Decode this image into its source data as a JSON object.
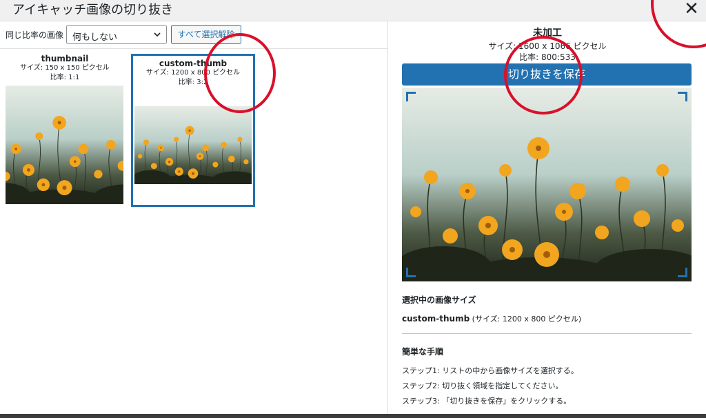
{
  "dialog": {
    "title": "アイキャッチ画像の切り抜き",
    "close_icon": "✕"
  },
  "toolbar": {
    "ratio_label": "同じ比率の画像",
    "select_value": "何もしない",
    "deselect_label": "すべて選択解除"
  },
  "sizes": [
    {
      "name": "thumbnail",
      "size": "サイズ: 150 x 150 ピクセル",
      "ratio": "比率: 1:1"
    },
    {
      "name": "custom-thumb",
      "size": "サイズ: 1200 x 800 ピクセル",
      "ratio": "比率: 3:2"
    }
  ],
  "preview": {
    "state": "未加工",
    "size": "サイズ: 1600 x 1066 ピクセル",
    "ratio": "比率: 800:533",
    "save_label": "切り抜きを保存"
  },
  "info": {
    "selected_heading": "選択中の画像サイズ",
    "selected_name": "custom-thumb",
    "selected_detail": " (サイズ: 1200 x 800 ピクセル)",
    "steps_heading": "簡単な手順",
    "steps": [
      "ステップ1: リストの中から画像サイズを選択する。",
      "ステップ2: 切り抜く領域を指定してください。",
      "ステップ3: 「切り抜きを保存」をクリックする。"
    ]
  },
  "colors": {
    "accent": "#2271b1",
    "annotation": "#d9102a",
    "sky": "#c9dbd4",
    "flower": "#f2a51e",
    "foliage": "#2f3a2a"
  }
}
